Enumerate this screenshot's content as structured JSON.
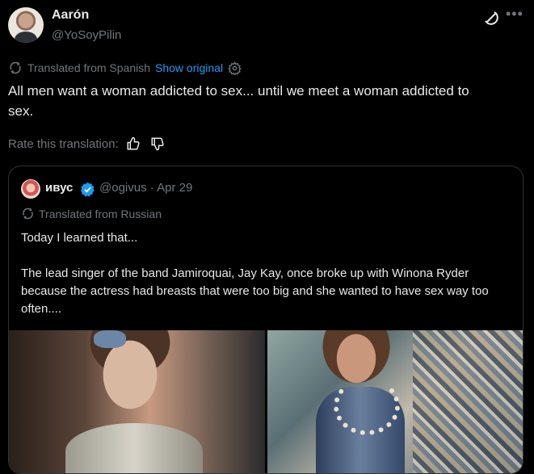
{
  "author": {
    "name": "Aarón",
    "handle": "@YoSoyPilin"
  },
  "icons": {
    "grok": "grok-icon",
    "more": "more-icon",
    "translate": "translate-icon",
    "settings": "gear-icon",
    "like": "thumbs-up-icon",
    "dislike": "thumbs-down-icon",
    "verified": "verified-badge-icon"
  },
  "translation": {
    "notice": "Translated from Spanish",
    "show_original": "Show original"
  },
  "post": {
    "text": "All men want a woman addicted to sex... until we meet a woman addicted to sex.",
    "rate_label": "Rate this translation:"
  },
  "quote": {
    "name": "ивус",
    "handle_date": "@ogivus · Apr 29",
    "translation_notice": "Translated from Russian",
    "paragraphs": [
      "Today I learned that...",
      "The lead singer of the band Jamiroquai, Jay Kay, once broke up with Winona Ryder because the actress had breasts that were too big and she wanted to have sex way too often...."
    ]
  },
  "colors": {
    "background": "#000000",
    "text": "#e7e9ea",
    "muted": "#71767b",
    "link": "#1d9bf0",
    "border": "#2f3336"
  }
}
